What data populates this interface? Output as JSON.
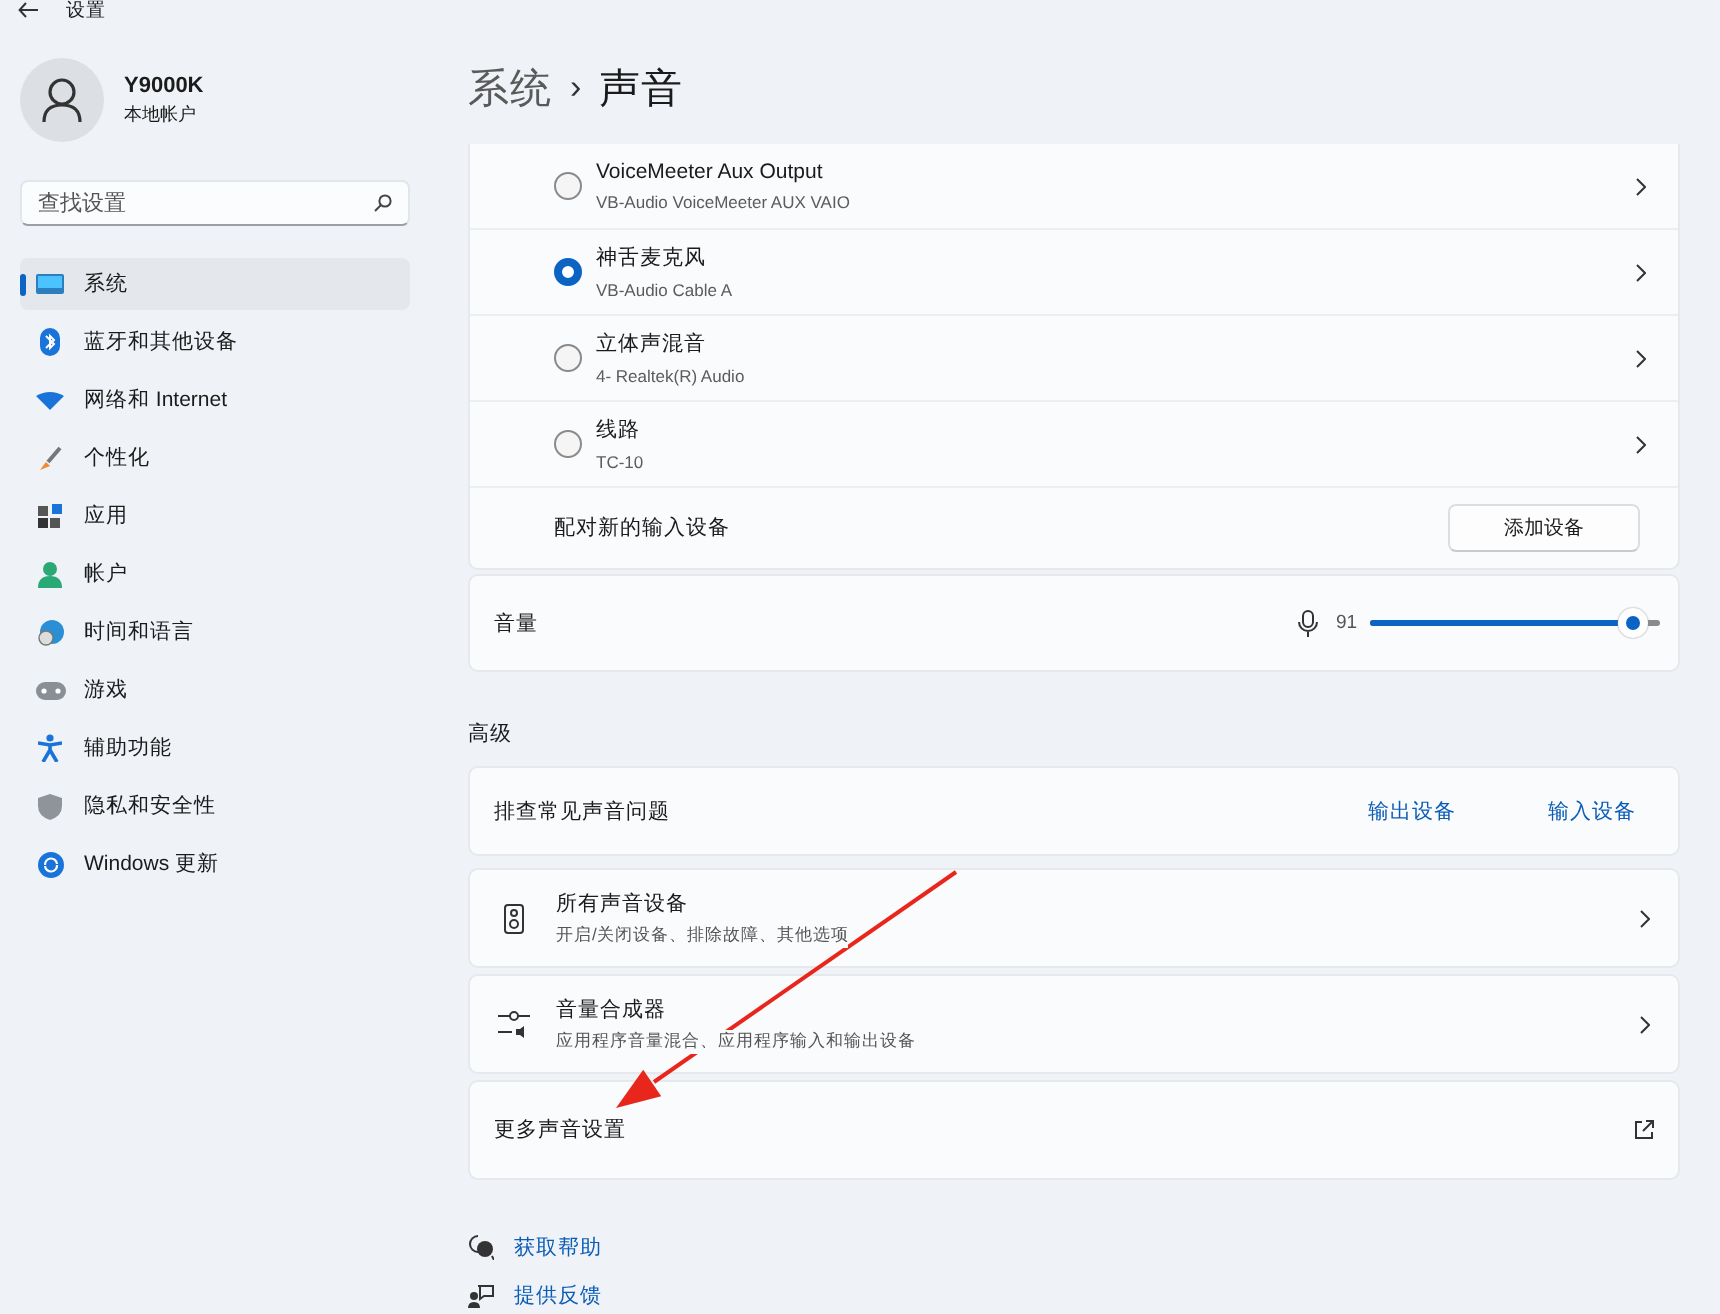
{
  "window": {
    "title": "设置"
  },
  "account": {
    "name": "Y9000K",
    "type": "本地帐户"
  },
  "search": {
    "placeholder": "查找设置"
  },
  "sidebar": {
    "items": [
      {
        "label": "系统",
        "selected": true
      },
      {
        "label": "蓝牙和其他设备",
        "selected": false
      },
      {
        "label": "网络和 Internet",
        "selected": false
      },
      {
        "label": "个性化",
        "selected": false
      },
      {
        "label": "应用",
        "selected": false
      },
      {
        "label": "帐户",
        "selected": false
      },
      {
        "label": "时间和语言",
        "selected": false
      },
      {
        "label": "游戏",
        "selected": false
      },
      {
        "label": "辅助功能",
        "selected": false
      },
      {
        "label": "隐私和安全性",
        "selected": false
      },
      {
        "label": "Windows 更新",
        "selected": false
      }
    ]
  },
  "breadcrumb": {
    "parent": "系统",
    "separator": "›",
    "current": "声音"
  },
  "input_devices": [
    {
      "name": "VoiceMeeter Aux Output",
      "detail": "VB-Audio VoiceMeeter AUX VAIO",
      "selected": false
    },
    {
      "name": "神舌麦克风",
      "detail": "VB-Audio Cable A",
      "selected": true
    },
    {
      "name": "立体声混音",
      "detail": "4- Realtek(R) Audio",
      "selected": false
    },
    {
      "name": "线路",
      "detail": "TC-10",
      "selected": false
    }
  ],
  "pair_row": {
    "label": "配对新的输入设备",
    "button": "添加设备"
  },
  "volume": {
    "label": "音量",
    "reading": "91",
    "level": 0.91
  },
  "advanced": {
    "heading": "高级",
    "troubleshoot": {
      "label": "排查常见声音问题",
      "links": [
        "输出设备",
        "输入设备"
      ]
    },
    "items": [
      {
        "kind": "speaker",
        "title": "所有声音设备",
        "subtitle": "开启/关闭设备、排除故障、其他选项"
      },
      {
        "kind": "mixer",
        "title": "音量合成器",
        "subtitle": "应用程序音量混合、应用程序输入和输出设备"
      },
      {
        "kind": "external",
        "title": "更多声音设置"
      }
    ]
  },
  "footer_links": [
    {
      "kind": "help",
      "label": "获取帮助"
    },
    {
      "kind": "feedback",
      "label": "提供反馈"
    }
  ],
  "annotation": {
    "kind": "arrow"
  }
}
